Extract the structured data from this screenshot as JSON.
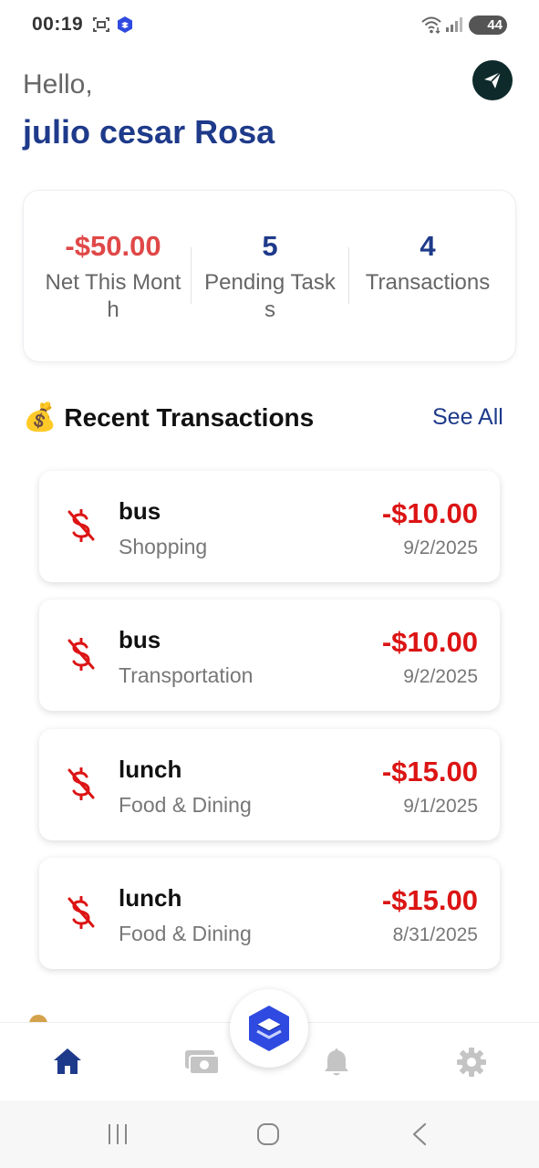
{
  "status_bar": {
    "time": "00:19",
    "battery": "44"
  },
  "header": {
    "greeting": "Hello,",
    "user_name": "julio cesar Rosa"
  },
  "stats": [
    {
      "value": "-$50.00",
      "label": "Net This Month",
      "color": "#e04848"
    },
    {
      "value": "5",
      "label": "Pending Tasks",
      "color": "#1e3a8a"
    },
    {
      "value": "4",
      "label": "Transactions",
      "color": "#1e3a8a"
    }
  ],
  "recent": {
    "icon": "💰",
    "title": "Recent Transactions",
    "see_all": "See All",
    "items": [
      {
        "title": "bus",
        "category": "Shopping",
        "amount": "-$10.00",
        "date": "9/2/2025"
      },
      {
        "title": "bus",
        "category": "Transportation",
        "amount": "-$10.00",
        "date": "9/2/2025"
      },
      {
        "title": "lunch",
        "category": "Food & Dining",
        "amount": "-$15.00",
        "date": "9/1/2025"
      },
      {
        "title": "lunch",
        "category": "Food & Dining",
        "amount": "-$15.00",
        "date": "8/31/2025"
      }
    ]
  },
  "bottom_nav": {
    "items": [
      {
        "icon": "home-icon",
        "active": true
      },
      {
        "icon": "money-icon",
        "active": false
      },
      {
        "icon": "bell-icon",
        "active": false
      },
      {
        "icon": "gear-icon",
        "active": false
      }
    ],
    "fab_icon": "layers-icon"
  },
  "colors": {
    "primary": "#1e3a8a",
    "negative": "#dc1414",
    "nav_inactive": "#c4c4c4"
  }
}
